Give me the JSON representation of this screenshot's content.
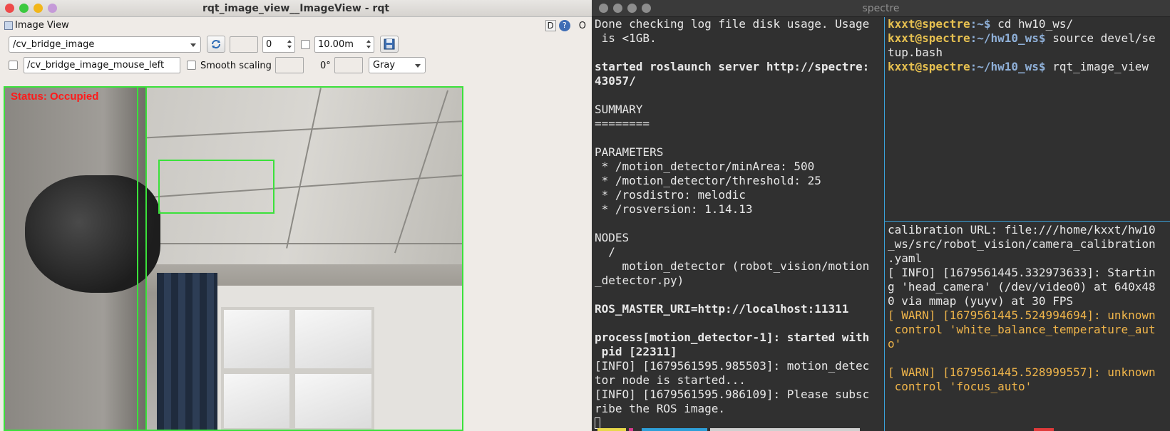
{
  "rqt": {
    "title": "rqt_image_view__ImageView - rqt",
    "plugin_label": "Image View",
    "plugin_buttons": {
      "d": "D",
      "help": "?",
      "close": "O"
    },
    "topic_select": "/cv_bridge_image",
    "spin_value": "0",
    "timeout_value": "10.00m",
    "mouse_topic": "/cv_bridge_image_mouse_left",
    "smooth_scaling_label": "Smooth scaling",
    "rotation": "0°",
    "color_scheme": "Gray",
    "status_overlay": "Status: Occupied"
  },
  "terminal": {
    "title": "spectre",
    "left_pane": {
      "lines": [
        {
          "t": "Done checking log file disk usage. Usage",
          "cls": ""
        },
        {
          "t": " is <1GB.",
          "cls": ""
        },
        {
          "t": "",
          "cls": ""
        },
        {
          "t": "started roslaunch server http://spectre:",
          "cls": "b"
        },
        {
          "t": "43057/",
          "cls": "b"
        },
        {
          "t": "",
          "cls": ""
        },
        {
          "t": "SUMMARY",
          "cls": ""
        },
        {
          "t": "========",
          "cls": ""
        },
        {
          "t": "",
          "cls": ""
        },
        {
          "t": "PARAMETERS",
          "cls": ""
        },
        {
          "t": " * /motion_detector/minArea: 500",
          "cls": ""
        },
        {
          "t": " * /motion_detector/threshold: 25",
          "cls": ""
        },
        {
          "t": " * /rosdistro: melodic",
          "cls": ""
        },
        {
          "t": " * /rosversion: 1.14.13",
          "cls": ""
        },
        {
          "t": "",
          "cls": ""
        },
        {
          "t": "NODES",
          "cls": ""
        },
        {
          "t": "  /",
          "cls": ""
        },
        {
          "t": "    motion_detector (robot_vision/motion",
          "cls": ""
        },
        {
          "t": "_detector.py)",
          "cls": ""
        },
        {
          "t": "",
          "cls": ""
        },
        {
          "t": "ROS_MASTER_URI=http://localhost:11311",
          "cls": "b"
        },
        {
          "t": "",
          "cls": ""
        },
        {
          "t": "process[motion_detector-1]: started with",
          "cls": "b"
        },
        {
          "t": " pid [22311]",
          "cls": "b"
        },
        {
          "t": "[INFO] [1679561595.985503]: motion_detec",
          "cls": ""
        },
        {
          "t": "tor node is started...",
          "cls": ""
        },
        {
          "t": "[INFO] [1679561595.986109]: Please subsc",
          "cls": ""
        },
        {
          "t": "ribe the ROS image.",
          "cls": ""
        }
      ]
    },
    "top_right_pane": {
      "prompt_user": "kxxt@spectre",
      "commands": [
        {
          "path": ":~$",
          "cmd": " cd hw10_ws/"
        },
        {
          "path": ":~/hw10_ws$",
          "cmd": " source devel/se"
        },
        {
          "path": "",
          "cmd": "tup.bash"
        },
        {
          "path": ":~/hw10_ws$",
          "cmd": " rqt_image_view"
        }
      ]
    },
    "bottom_right_pane": {
      "lines": [
        {
          "t": "calibration URL: file:///home/kxxt/hw10",
          "cls": ""
        },
        {
          "t": "_ws/src/robot_vision/camera_calibration",
          "cls": ""
        },
        {
          "t": ".yaml",
          "cls": ""
        },
        {
          "t": "[ INFO] [1679561445.332973633]: Startin",
          "cls": ""
        },
        {
          "t": "g 'head_camera' (/dev/video0) at 640x48",
          "cls": ""
        },
        {
          "t": "0 via mmap (yuyv) at 30 FPS",
          "cls": ""
        },
        {
          "t": "[ WARN] [1679561445.524994694]: unknown",
          "cls": "warn"
        },
        {
          "t": " control 'white_balance_temperature_aut",
          "cls": "warn"
        },
        {
          "t": "o'",
          "cls": "warn"
        },
        {
          "t": "",
          "cls": ""
        },
        {
          "t": "[ WARN] [1679561445.528999557]: unknown",
          "cls": "warn"
        },
        {
          "t": " control 'focus_auto'",
          "cls": "warn"
        }
      ]
    }
  },
  "colors": {
    "bbox_green": "#3be13b",
    "status_red": "#ff1a1a",
    "pane_divider": "#3aa0d8",
    "warn": "#f0b54a",
    "prompt_user": "#e6c050",
    "prompt_path": "#8fb0d8"
  }
}
